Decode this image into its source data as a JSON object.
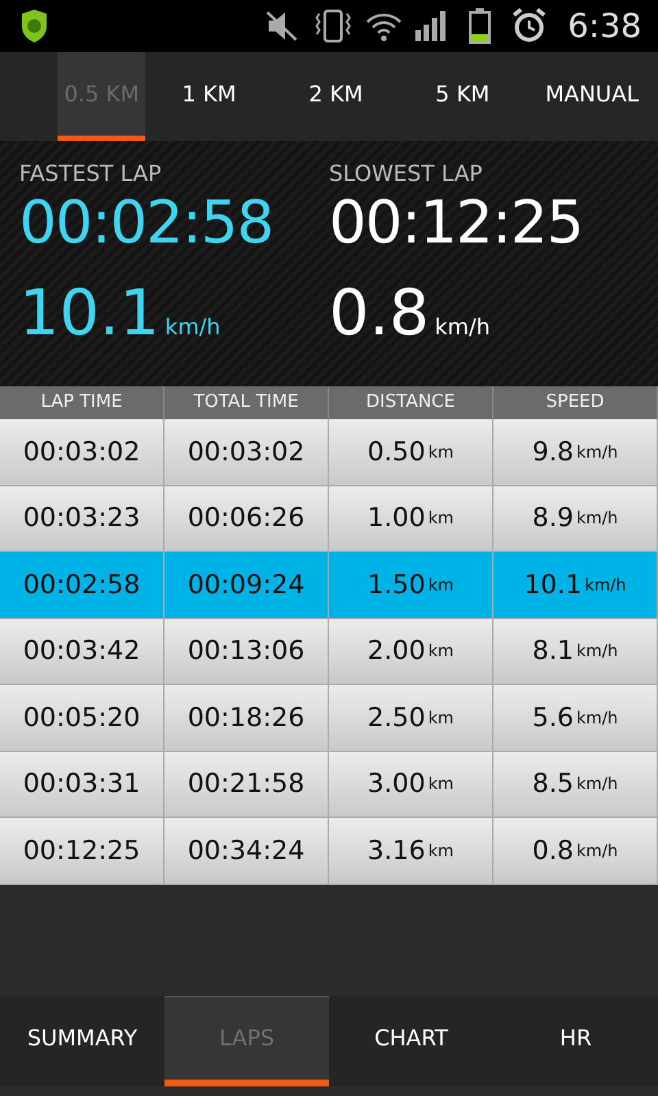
{
  "status_bar": {
    "time": "6:38"
  },
  "interval_tabs": [
    {
      "label": "0.5 KM",
      "selected": true
    },
    {
      "label": "1 KM",
      "selected": false
    },
    {
      "label": "2 KM",
      "selected": false
    },
    {
      "label": "5 KM",
      "selected": false
    },
    {
      "label": "MANUAL",
      "selected": false
    }
  ],
  "fastest_lap": {
    "label": "FASTEST LAP",
    "time": "00:02:58",
    "speed": "10.1",
    "unit": "km/h"
  },
  "slowest_lap": {
    "label": "SLOWEST LAP",
    "time": "00:12:25",
    "speed": "0.8",
    "unit": "km/h"
  },
  "table": {
    "columns": [
      "LAP TIME",
      "TOTAL TIME",
      "DISTANCE",
      "SPEED"
    ],
    "rows": [
      {
        "lap_time": "00:03:02",
        "total_time": "00:03:02",
        "distance": "0.50",
        "distance_unit": "km",
        "speed": "9.8",
        "speed_unit": "km/h",
        "selected": false
      },
      {
        "lap_time": "00:03:23",
        "total_time": "00:06:26",
        "distance": "1.00",
        "distance_unit": "km",
        "speed": "8.9",
        "speed_unit": "km/h",
        "selected": false
      },
      {
        "lap_time": "00:02:58",
        "total_time": "00:09:24",
        "distance": "1.50",
        "distance_unit": "km",
        "speed": "10.1",
        "speed_unit": "km/h",
        "selected": true
      },
      {
        "lap_time": "00:03:42",
        "total_time": "00:13:06",
        "distance": "2.00",
        "distance_unit": "km",
        "speed": "8.1",
        "speed_unit": "km/h",
        "selected": false
      },
      {
        "lap_time": "00:05:20",
        "total_time": "00:18:26",
        "distance": "2.50",
        "distance_unit": "km",
        "speed": "5.6",
        "speed_unit": "km/h",
        "selected": false
      },
      {
        "lap_time": "00:03:31",
        "total_time": "00:21:58",
        "distance": "3.00",
        "distance_unit": "km",
        "speed": "8.5",
        "speed_unit": "km/h",
        "selected": false
      },
      {
        "lap_time": "00:12:25",
        "total_time": "00:34:24",
        "distance": "3.16",
        "distance_unit": "km",
        "speed": "0.8",
        "speed_unit": "km/h",
        "selected": false
      }
    ]
  },
  "bottom_tabs": [
    {
      "label": "SUMMARY",
      "selected": false
    },
    {
      "label": "LAPS",
      "selected": true
    },
    {
      "label": "CHART",
      "selected": false
    },
    {
      "label": "HR",
      "selected": false
    }
  ]
}
